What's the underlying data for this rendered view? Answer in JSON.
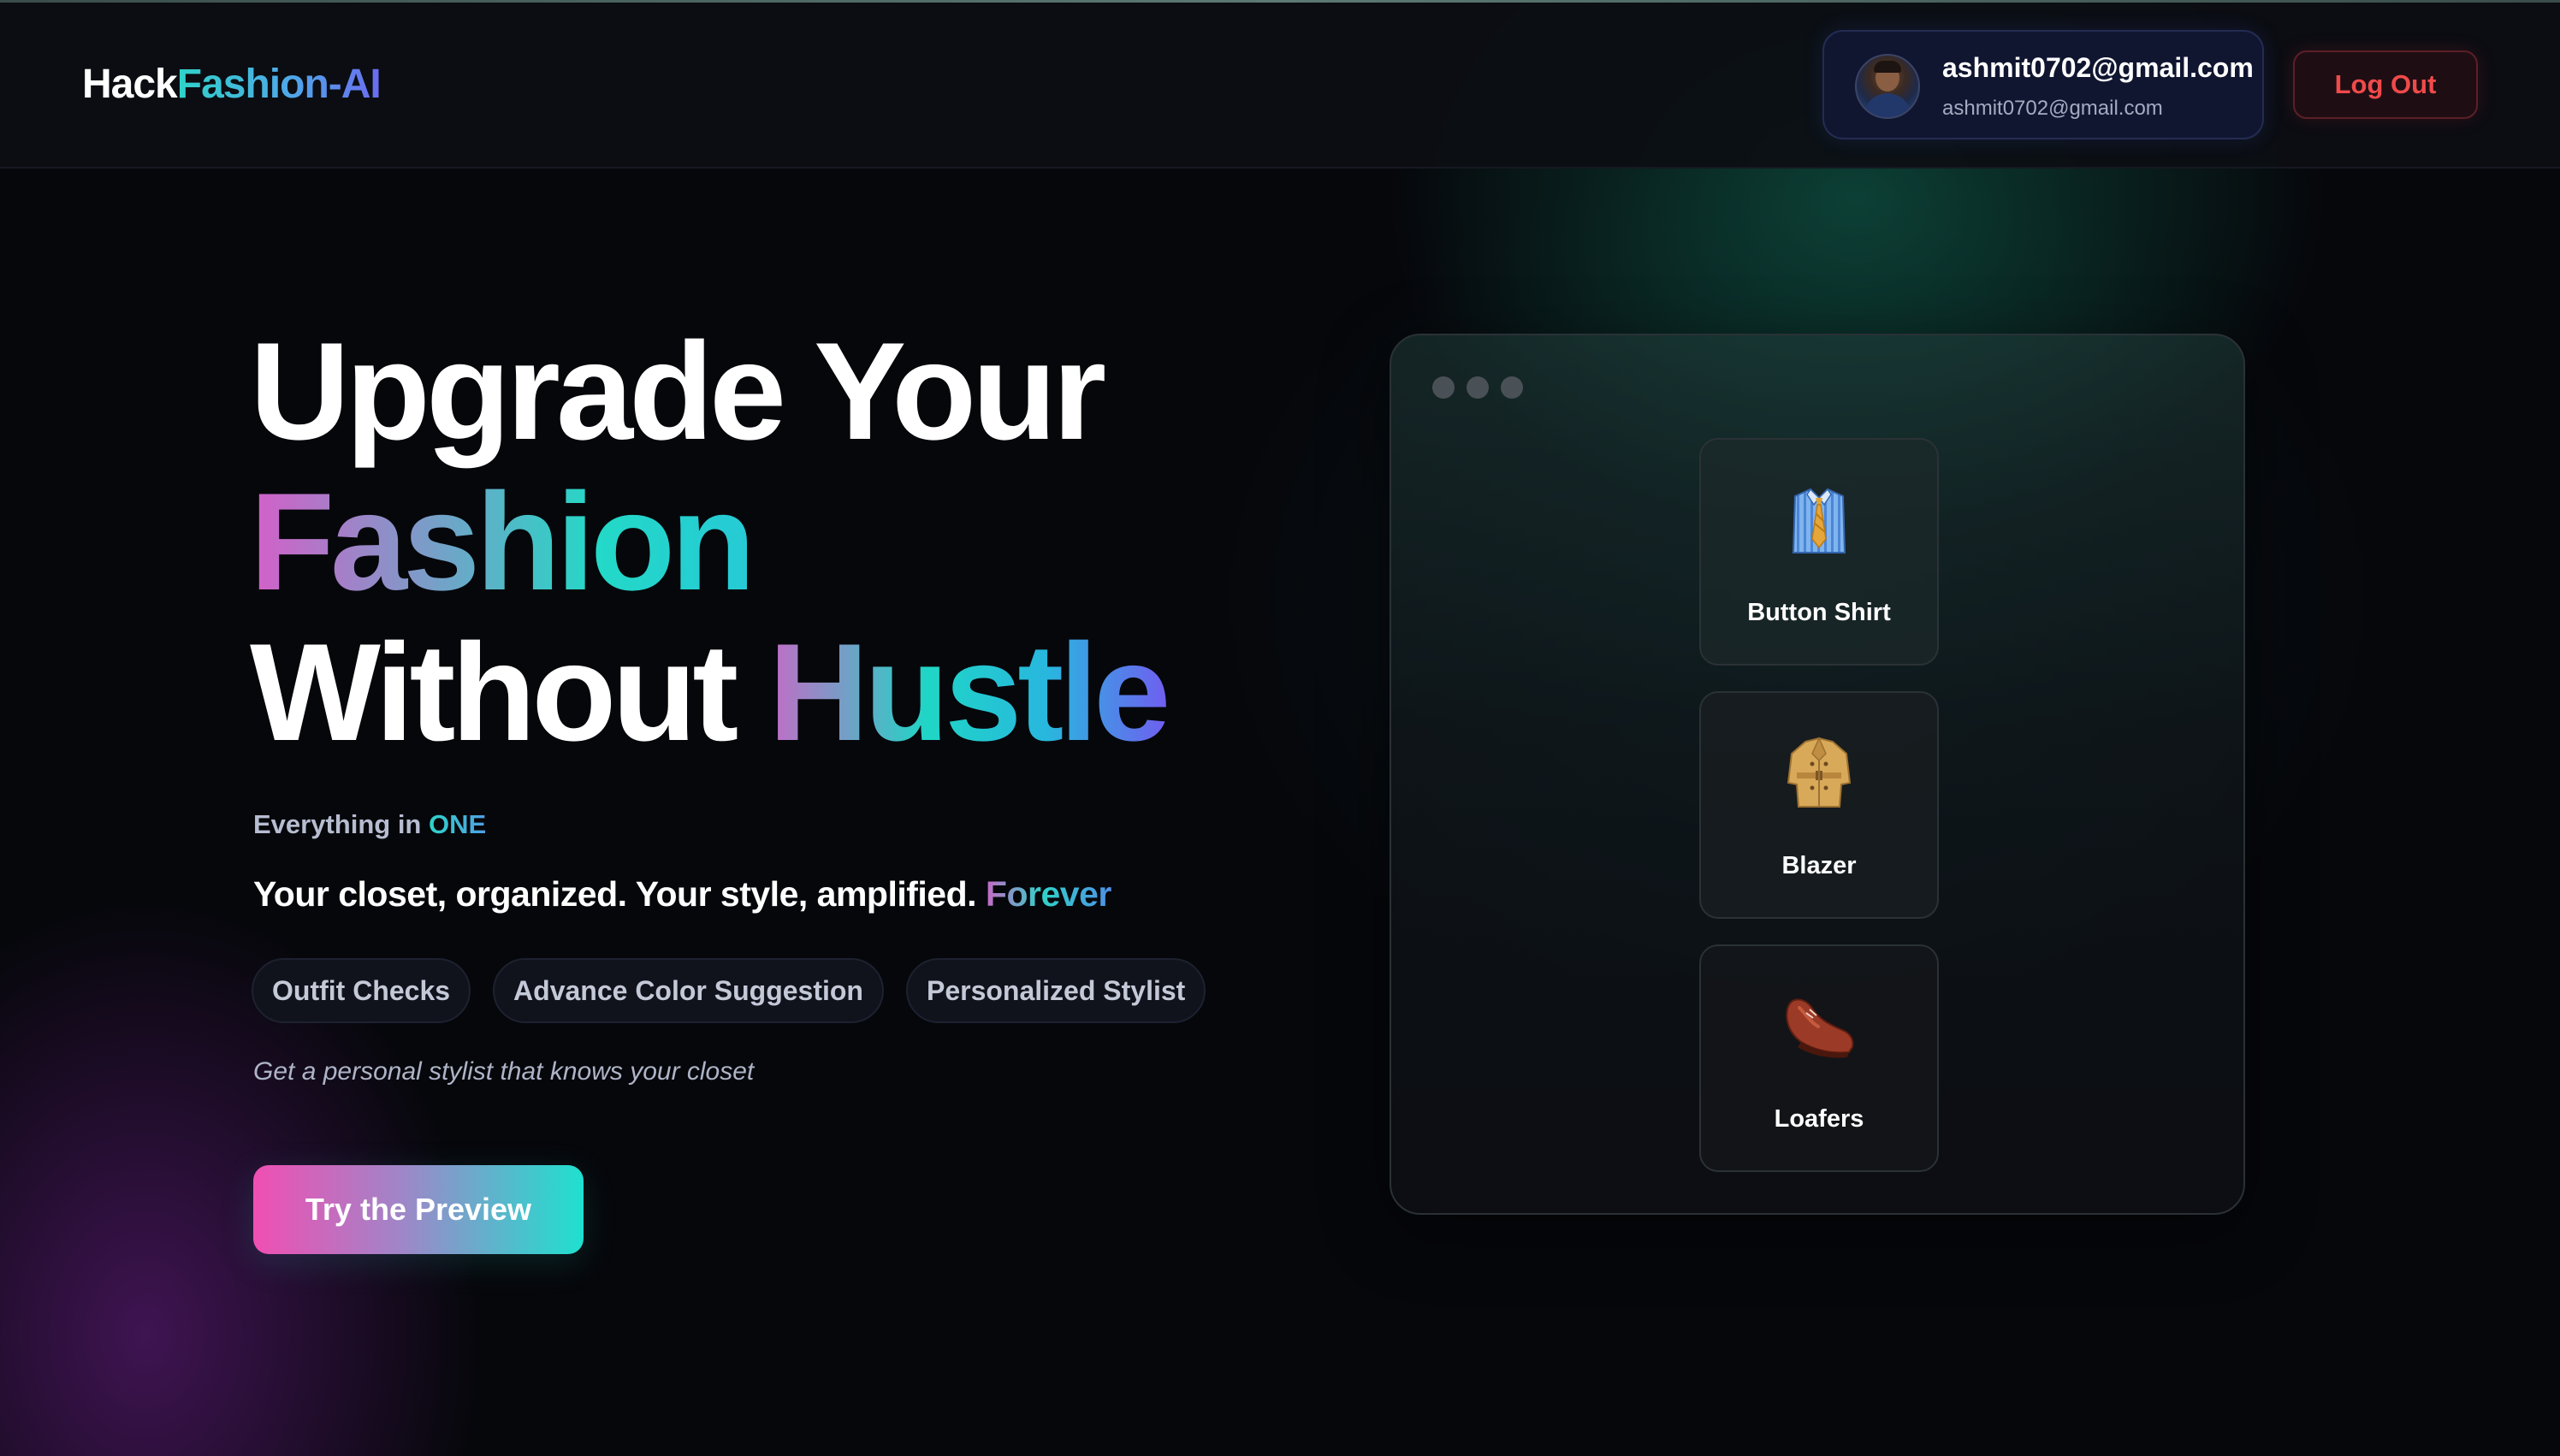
{
  "header": {
    "logo_part1": "Hack",
    "logo_part2": "Fashion-AI",
    "user_name": "ashmit0702@gmail.com",
    "user_email": "ashmit0702@gmail.com",
    "logout_label": "Log Out"
  },
  "hero": {
    "title_line1": "Upgrade Your",
    "title_line2": "Fashion",
    "title_line3_plain": "Without ",
    "title_line3_accent": "Hustle",
    "eyebrow_plain": "Everything in ",
    "eyebrow_accent": "ONE",
    "tagline_plain": "Your closet, organized. Your style, amplified. ",
    "tagline_accent": "Forever",
    "features": [
      "Outfit Checks",
      "Advance Color Suggestion",
      "Personalized Stylist"
    ],
    "subnote": "Get a personal stylist that knows your closet",
    "cta_label": "Try the Preview"
  },
  "preview": {
    "items": [
      {
        "label": "Button Shirt",
        "icon": "shirt-tie-icon"
      },
      {
        "label": "Blazer",
        "icon": "coat-icon"
      },
      {
        "label": "Loafers",
        "icon": "shoe-icon"
      }
    ]
  },
  "colors": {
    "background": "#06070b",
    "accent_teal": "#23d9c7",
    "accent_pink": "#f04fb2",
    "accent_violet": "#7056f0",
    "logout_red": "#f04a4a"
  }
}
